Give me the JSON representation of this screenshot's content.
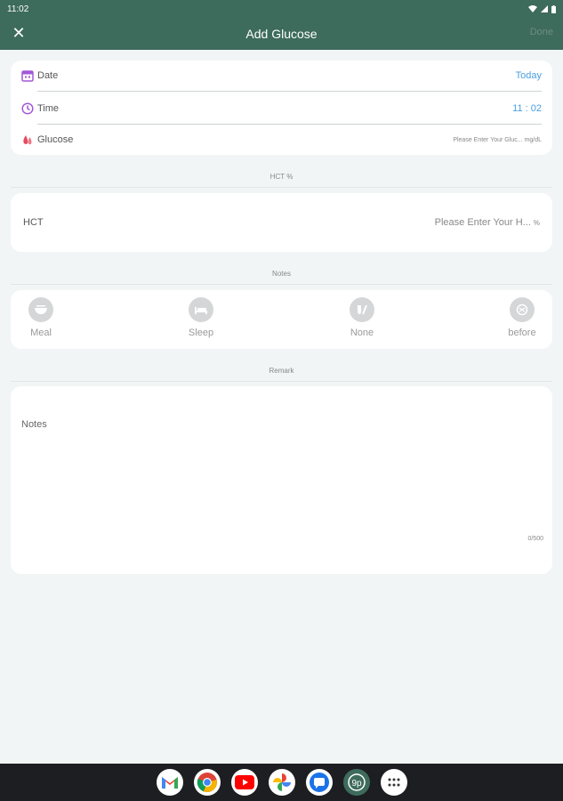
{
  "status_bar": {
    "time": "11:02"
  },
  "app_bar": {
    "title": "Add Glucose",
    "done_label": "Done",
    "close_symbol": "✕"
  },
  "form": {
    "date": {
      "label": "Date",
      "value": "Today"
    },
    "time": {
      "label": "Time",
      "value": "11 : 02"
    },
    "glucose": {
      "label": "Glucose",
      "placeholder": "Please Enter Your Gluc...",
      "unit": "mg/dL"
    }
  },
  "hct_section": {
    "title": "HCT %",
    "label": "HCT",
    "placeholder": "Please Enter Your H...",
    "unit": "%"
  },
  "notes_section": {
    "title": "Notes",
    "items": [
      {
        "label": "Meal",
        "icon": "meal-icon"
      },
      {
        "label": "Sleep",
        "icon": "sleep-icon"
      },
      {
        "label": "None",
        "icon": "none-icon"
      },
      {
        "label": "before",
        "icon": "before-icon"
      }
    ]
  },
  "remark_section": {
    "title": "Remark",
    "placeholder": "Notes",
    "counter": "0/500"
  },
  "nav_bar": {
    "apps": [
      "gmail-icon",
      "chrome-icon",
      "youtube-icon",
      "photos-icon",
      "messages-icon",
      "glucose-app-icon",
      "app-drawer-icon"
    ]
  },
  "colors": {
    "header": "#3d6b5c",
    "accent": "#4a9fe0",
    "date_icon": "#a259d9",
    "glucose_icon": "#e84a5f"
  }
}
